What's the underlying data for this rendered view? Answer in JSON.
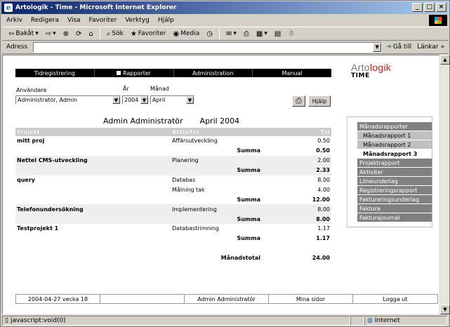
{
  "window": {
    "title": "Artologik - Time - Microsoft Internet Explorer",
    "controls": {
      "minimize": "_",
      "maximize": "□",
      "close": "×"
    }
  },
  "menubar": [
    "Arkiv",
    "Redigera",
    "Visa",
    "Favoriter",
    "Verktyg",
    "Hjälp"
  ],
  "toolbar": {
    "back": "Bakåt",
    "search": "Sök",
    "favorites": "Favoriter",
    "media": "Media"
  },
  "address": {
    "label": "Adress",
    "value": "",
    "go": "Gå till",
    "links": "Länkar"
  },
  "nav": {
    "tidregistrering": "Tidregistrering",
    "rapporter": "Rapporter",
    "administration": "Administration",
    "manual": "Manual"
  },
  "logo": {
    "brand_a": "Arto",
    "brand_b": "logik",
    "sub": "TIME"
  },
  "filters": {
    "user_label": "Användare",
    "user_value": "Administratör, Admin",
    "year_label": "År",
    "year_value": "2004",
    "month_label": "Månad",
    "month_value": "April"
  },
  "buttons": {
    "help": "Hjälp"
  },
  "report": {
    "person": "Admin Administratör",
    "period": "April 2004",
    "col_project": "Projekt",
    "col_activity": "Aktivitet",
    "col_time": "Tid",
    "rows": [
      {
        "project": "mitt proj",
        "activity": "Affärsutveckling",
        "time": "0.50",
        "shade": false
      },
      {
        "project": "",
        "activity": "Summa",
        "time": "0.50",
        "sum": true,
        "shade": false
      },
      {
        "project": "Nettel CMS-utveckling",
        "activity": "Planering",
        "time": "2.00",
        "shade": true
      },
      {
        "project": "",
        "activity": "Summa",
        "time": "2.33",
        "sum": true,
        "shade": true
      },
      {
        "project": "query",
        "activity": "Databas",
        "time": "8.00",
        "shade": false
      },
      {
        "project": "",
        "activity": "Målning tak",
        "time": "4.00",
        "shade": false
      },
      {
        "project": "",
        "activity": "Summa",
        "time": "12.00",
        "sum": true,
        "shade": false
      },
      {
        "project": "Telefonundersökning",
        "activity": "Implementering",
        "time": "8.00",
        "shade": true
      },
      {
        "project": "",
        "activity": "Summa",
        "time": "8.00",
        "sum": true,
        "shade": true
      },
      {
        "project": "Testprojekt 1",
        "activity": "Databastrimning",
        "time": "1.17",
        "shade": false
      },
      {
        "project": "",
        "activity": "Summa",
        "time": "1.17",
        "sum": true,
        "shade": false
      }
    ],
    "total_label": "Månadstotal",
    "total_value": "24.00"
  },
  "sidemenu": [
    {
      "label": "Månadsrapporter",
      "kind": "head"
    },
    {
      "label": "Månadsrapport 1",
      "kind": "sub"
    },
    {
      "label": "Månadsrapport 2",
      "kind": "sub"
    },
    {
      "label": "Månadsrapport 3",
      "kind": "active"
    },
    {
      "label": "Projektrapport",
      "kind": "head"
    },
    {
      "label": "Aktiviter",
      "kind": "head"
    },
    {
      "label": "Löneunderlag",
      "kind": "head"
    },
    {
      "label": "Registreringsrapport",
      "kind": "head"
    },
    {
      "label": "Faktureringsunderlag",
      "kind": "head"
    },
    {
      "label": "Faktura",
      "kind": "head"
    },
    {
      "label": "Fakturajournal",
      "kind": "head"
    }
  ],
  "footer": {
    "date": "2004-04-27 vecka 18",
    "blank": "",
    "user": "Admin Administratör",
    "settings": "Mina sidor",
    "logout": "Logga ut"
  },
  "status": {
    "left": "javascript:void(0)",
    "zone": "Internet"
  }
}
